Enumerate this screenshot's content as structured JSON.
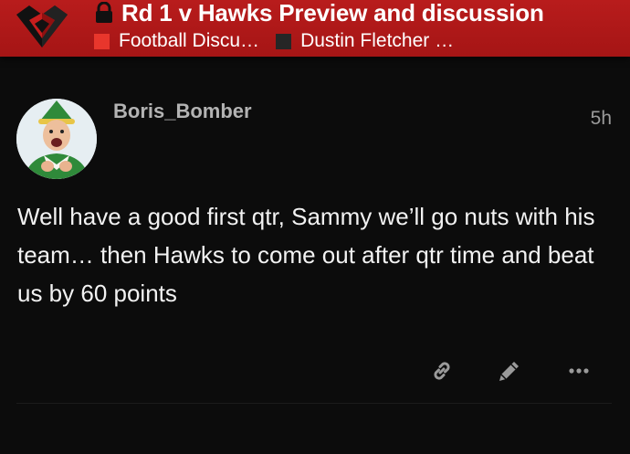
{
  "topic": {
    "title": "Rd 1 v Hawks Preview and discussion",
    "categories": [
      {
        "label": "Football Discu…",
        "color": "#e8362c"
      },
      {
        "label": "Dustin Fletcher …",
        "color": "#262626"
      }
    ]
  },
  "post": {
    "username": "Boris_Bomber",
    "time": "5h",
    "body": "Well have a good first qtr, Sammy we’ll go nuts with his team… then Hawks to come out after qtr time and beat us by 60 points",
    "actions": [
      {
        "name": "link-icon"
      },
      {
        "name": "edit-pencil-icon"
      },
      {
        "name": "more-options-icon"
      }
    ]
  },
  "colors": {
    "header_bg": "#b81c1c",
    "page_bg": "#0c0c0c",
    "text": "#f2f2f2",
    "muted": "#9a9a9a"
  }
}
